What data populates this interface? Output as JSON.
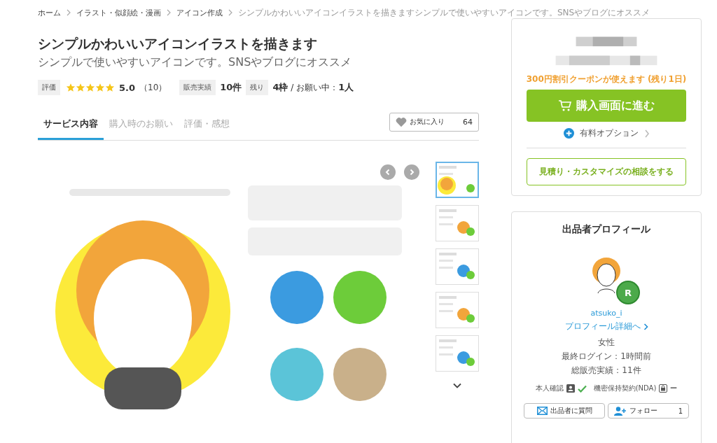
{
  "breadcrumb": [
    {
      "label": "ホーム",
      "current": false
    },
    {
      "label": "イラスト・似顔絵・漫画",
      "current": false
    },
    {
      "label": "アイコン作成",
      "current": false
    },
    {
      "label": "シンプルかわいいアイコンイラストを描きますシンプルで使いやすいアイコンです。SNSやブログにオススメ",
      "current": true
    }
  ],
  "title": "シンプルかわいいアイコンイラストを描きます",
  "subtitle": "シンプルで使いやすいアイコンです。SNSやブログにオススメ",
  "rating": {
    "label": "評価",
    "stars": 5,
    "score": "5.0",
    "count": "（10）"
  },
  "sales": {
    "label": "販売実績",
    "value": "10件"
  },
  "remaining": {
    "label": "残り",
    "value": "**4枠** / お願い中：**1人**"
  },
  "tabs": [
    {
      "label": "サービス内容",
      "selected": true
    },
    {
      "label": "購入時のお願い",
      "selected": false
    },
    {
      "label": "評価・感想",
      "selected": false
    }
  ],
  "favorite": {
    "label": "お気に入り",
    "count": "64"
  },
  "gallery": {
    "thumbnails": [
      {
        "selected": true
      },
      {
        "selected": false
      },
      {
        "selected": false
      },
      {
        "selected": false
      },
      {
        "selected": false
      }
    ]
  },
  "purchase": {
    "coupon": "300円割引クーポンが使えます (残り1日)",
    "buy_button": "購入画面に進む",
    "option": "有料オプション",
    "consult_button": "見積り・カスタマイズの相談をする"
  },
  "profile": {
    "heading": "出品者プロフィール",
    "badge": "R",
    "username": "atsuko_i",
    "detail_link": "プロフィール詳細へ",
    "gender": "女性",
    "last_login": "最終ログイン：1時間前",
    "total_sales": "総販売実績：11件",
    "identity_label": "本人確認",
    "identity_verified": true,
    "nda_label": "機密保持契約(NDA)",
    "nda_value": "ー",
    "question_button": "出品者に質問",
    "follow_button": "フォロー",
    "follow_count": "1"
  }
}
